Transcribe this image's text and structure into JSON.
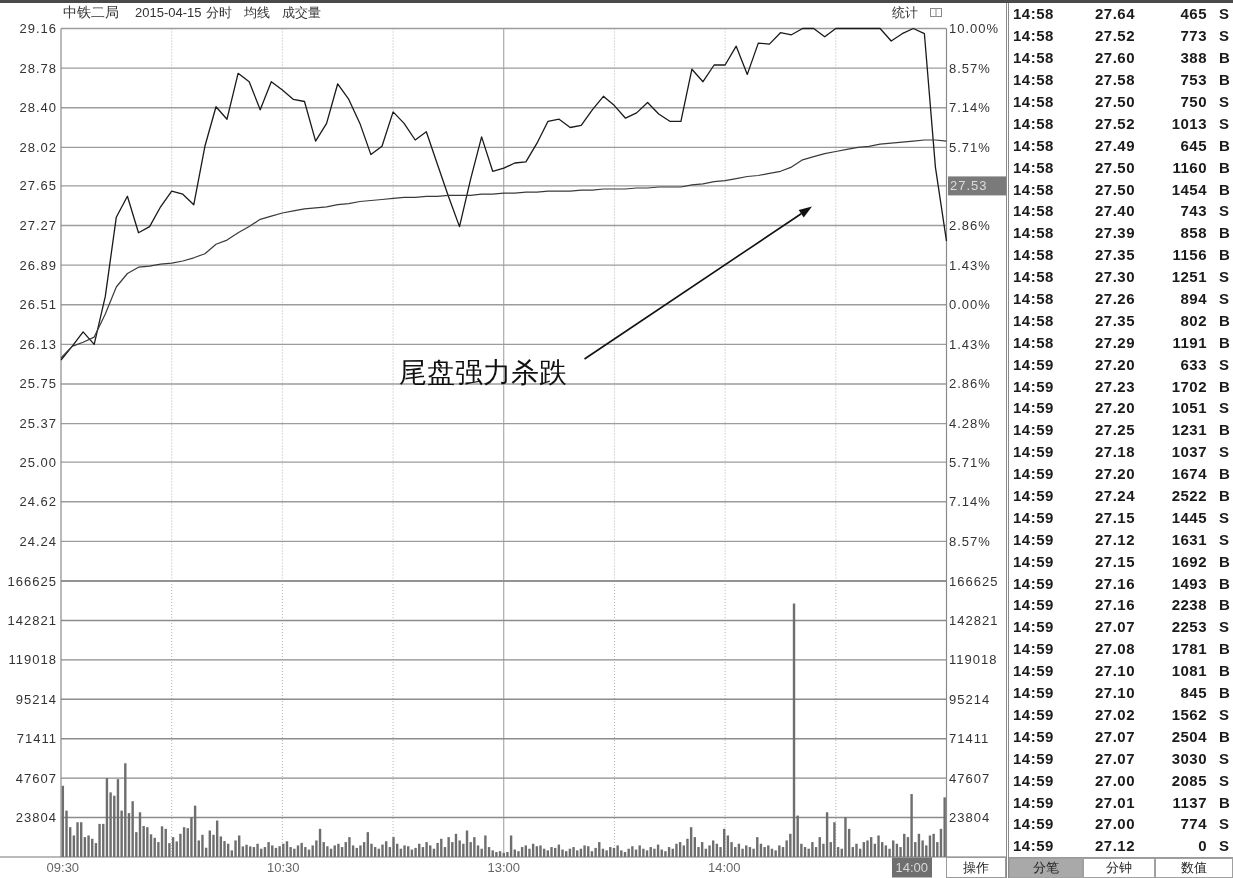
{
  "chart_header": {
    "stock_name": "中铁二局",
    "date": "2015-04-15",
    "stats_label": "统计"
  },
  "price_chart": {
    "chart_data": {
      "type": "line",
      "categories": [
        null,
        null,
        null,
        null,
        null,
        null,
        null,
        null,
        null,
        null,
        null,
        null,
        null,
        null,
        null,
        null,
        null,
        null,
        null,
        null,
        null,
        null,
        null,
        null,
        null,
        null,
        null,
        null,
        null,
        null,
        null,
        null,
        null,
        null,
        null,
        null,
        null,
        null,
        null,
        null,
        null,
        null,
        null,
        null,
        null,
        null,
        null,
        null,
        null,
        null,
        null,
        null,
        null,
        null,
        null,
        null,
        null,
        null,
        null,
        null,
        null,
        null,
        null,
        null,
        null,
        null,
        null,
        null,
        null,
        null,
        null,
        null,
        null,
        null,
        null,
        null,
        null,
        null,
        null,
        null,
        null
      ],
      "series": [
        {
          "name": "分时",
          "color": "#1a1a1a",
          "values": [
            25.98,
            26.11,
            26.25,
            26.13,
            26.59,
            27.35,
            27.55,
            27.2,
            27.26,
            27.45,
            27.6,
            27.57,
            27.47,
            28.03,
            28.41,
            28.29,
            28.73,
            28.65,
            28.38,
            28.65,
            28.57,
            28.48,
            28.46,
            28.08,
            28.25,
            28.63,
            28.48,
            28.25,
            27.95,
            28.03,
            28.36,
            28.25,
            28.09,
            28.17,
            27.86,
            27.55,
            27.26,
            27.71,
            28.12,
            27.79,
            27.82,
            27.87,
            27.88,
            28.06,
            28.27,
            28.29,
            28.21,
            28.23,
            28.38,
            28.51,
            28.42,
            28.3,
            28.35,
            28.45,
            28.34,
            28.27,
            28.27,
            28.77,
            28.65,
            28.81,
            28.81,
            28.99,
            28.72,
            29.02,
            29.01,
            29.12,
            29.1,
            29.16,
            29.16,
            29.08,
            29.16,
            29.16,
            29.16,
            29.16,
            29.16,
            29.04,
            29.11,
            29.16,
            29.11,
            27.83,
            27.12
          ]
        },
        {
          "name": "均线",
          "color": "#3a3a3a",
          "values": [
            26.0,
            26.11,
            26.15,
            26.2,
            26.42,
            26.68,
            26.81,
            26.87,
            26.88,
            26.9,
            26.91,
            26.93,
            26.96,
            27.0,
            27.09,
            27.13,
            27.2,
            27.26,
            27.33,
            27.36,
            27.39,
            27.41,
            27.43,
            27.44,
            27.45,
            27.47,
            27.48,
            27.5,
            27.51,
            27.52,
            27.53,
            27.54,
            27.54,
            27.55,
            27.55,
            27.56,
            27.56,
            27.56,
            27.57,
            27.57,
            27.58,
            27.58,
            27.59,
            27.59,
            27.6,
            27.6,
            27.6,
            27.61,
            27.61,
            27.62,
            27.62,
            27.62,
            27.63,
            27.63,
            27.64,
            27.64,
            27.64,
            27.66,
            27.67,
            27.69,
            27.7,
            27.72,
            27.74,
            27.75,
            27.77,
            27.79,
            27.83,
            27.9,
            27.93,
            27.96,
            27.98,
            28.0,
            28.02,
            28.03,
            28.05,
            28.06,
            28.07,
            28.08,
            28.09,
            28.09,
            28.08
          ]
        }
      ],
      "ylim": [
        23.86,
        29.16
      ],
      "grid": true,
      "yticks": [
        {
          "value": 29.16,
          "label": "29.16"
        },
        {
          "value": 28.78,
          "label": "28.78"
        },
        {
          "value": 28.4,
          "label": "28.40"
        },
        {
          "value": 28.02,
          "label": "28.02"
        },
        {
          "value": 27.65,
          "label": "27.65"
        },
        {
          "value": 27.27,
          "label": "27.27"
        },
        {
          "value": 26.89,
          "label": "26.89"
        },
        {
          "value": 26.51,
          "label": "26.51"
        },
        {
          "value": 26.13,
          "label": "26.13"
        },
        {
          "value": 25.75,
          "label": "25.75"
        },
        {
          "value": 25.37,
          "label": "25.37"
        },
        {
          "value": 25.0,
          "label": "25.00"
        },
        {
          "value": 24.62,
          "label": "24.62"
        },
        {
          "value": 24.24,
          "label": "24.24"
        }
      ],
      "annotations": [
        "尾盘强力杀跌"
      ]
    },
    "right_axis": [
      {
        "kind": "percent",
        "label": "10.00%"
      },
      {
        "kind": "percent",
        "label": "8.57%"
      },
      {
        "kind": "percent",
        "label": "7.14%"
      },
      {
        "kind": "percent",
        "label": "5.71%"
      },
      {
        "kind": "last_price",
        "label": "27.53"
      },
      {
        "kind": "percent",
        "label": "2.86%"
      },
      {
        "kind": "percent",
        "label": "1.43%"
      },
      {
        "kind": "percent",
        "label": "0.00%"
      },
      {
        "kind": "percent",
        "label": "1.43%"
      },
      {
        "kind": "percent",
        "label": "2.86%"
      },
      {
        "kind": "percent",
        "label": "4.28%"
      },
      {
        "kind": "percent",
        "label": "5.71%"
      },
      {
        "kind": "percent",
        "label": "7.14%"
      },
      {
        "kind": "percent",
        "label": "8.57%"
      }
    ]
  },
  "volume_chart": {
    "chart_data": {
      "type": "bar",
      "categories": [
        "09:30",
        null,
        null,
        null,
        null,
        null,
        null,
        null,
        null,
        null,
        null,
        null,
        null,
        null,
        null,
        null,
        null,
        null,
        null,
        null,
        null,
        null,
        null,
        null,
        null,
        null,
        null,
        null,
        null,
        null,
        null,
        null,
        null,
        null,
        null,
        null,
        null,
        null,
        null,
        null,
        null,
        null,
        null,
        null,
        null,
        null,
        null,
        null,
        null,
        null,
        null,
        null,
        null,
        null,
        null,
        null,
        null,
        null,
        null,
        null,
        "10:30",
        null,
        null,
        null,
        null,
        null,
        null,
        null,
        null,
        null,
        null,
        null,
        null,
        null,
        null,
        null,
        null,
        null,
        null,
        null,
        null,
        null,
        null,
        null,
        null,
        null,
        null,
        null,
        null,
        null,
        null,
        null,
        null,
        null,
        null,
        null,
        null,
        null,
        null,
        null,
        null,
        null,
        null,
        null,
        null,
        null,
        null,
        null,
        null,
        null,
        null,
        null,
        null,
        null,
        null,
        null,
        null,
        null,
        null,
        null,
        "13:00",
        null,
        null,
        null,
        null,
        null,
        null,
        null,
        null,
        null,
        null,
        null,
        null,
        null,
        null,
        null,
        null,
        null,
        null,
        null,
        null,
        null,
        null,
        null,
        null,
        null,
        null,
        null,
        null,
        null,
        null,
        null,
        null,
        null,
        null,
        null,
        null,
        null,
        null,
        null,
        null,
        null,
        null,
        null,
        null,
        null,
        null,
        null,
        null,
        null,
        null,
        null,
        null,
        null,
        null,
        null,
        null,
        null,
        null,
        null,
        "14:00",
        null,
        null,
        null,
        null,
        null,
        null,
        null,
        null,
        null,
        null,
        null,
        null,
        null,
        null,
        null,
        null,
        null,
        null,
        null,
        null,
        null,
        null,
        null,
        null,
        null,
        null,
        null,
        null,
        null,
        null,
        null,
        null,
        null,
        null,
        null,
        null,
        null,
        null,
        null,
        null,
        null,
        null,
        null,
        null,
        null,
        null,
        null,
        null,
        null,
        null,
        null,
        null,
        null,
        null,
        null,
        null,
        null,
        null,
        null,
        null
      ],
      "series": [
        {
          "name": "成交量",
          "color": "#6e6e6e",
          "values": [
            43000,
            28000,
            18000,
            13000,
            21000,
            21000,
            12000,
            13000,
            11000,
            8400,
            20000,
            20000,
            47600,
            39000,
            37000,
            47000,
            28000,
            56600,
            26500,
            33700,
            15000,
            27000,
            18700,
            18000,
            13700,
            11600,
            9000,
            18500,
            17000,
            8400,
            12000,
            9400,
            14000,
            18000,
            17400,
            24000,
            31000,
            10000,
            13400,
            5600,
            16000,
            13400,
            22000,
            12400,
            9600,
            8000,
            4000,
            10000,
            13000,
            6400,
            7400,
            6400,
            6000,
            8000,
            5000,
            6000,
            9000,
            7000,
            5500,
            6500,
            8000,
            9500,
            6000,
            5000,
            7000,
            8500,
            6000,
            4500,
            7000,
            10000,
            17000,
            9000,
            6500,
            5000,
            7000,
            8000,
            6000,
            9000,
            12000,
            7000,
            5500,
            7000,
            9000,
            15000,
            8000,
            6000,
            5000,
            7500,
            9500,
            6000,
            12000,
            8000,
            5000,
            7000,
            6500,
            4500,
            5500,
            8000,
            6000,
            9000,
            7000,
            5000,
            8500,
            11000,
            6000,
            12000,
            9000,
            14000,
            10000,
            8000,
            16000,
            9000,
            12000,
            7000,
            5000,
            13000,
            6000,
            4000,
            3000,
            3500,
            2500,
            3000,
            13000,
            4500,
            3500,
            6000,
            7000,
            5000,
            8000,
            6500,
            7000,
            5000,
            4000,
            6000,
            5500,
            7500,
            4500,
            3500,
            5000,
            6000,
            4000,
            5000,
            7000,
            6500,
            3500,
            5500,
            9000,
            5000,
            4000,
            6000,
            5500,
            7000,
            4000,
            3000,
            5000,
            6500,
            4500,
            7000,
            5000,
            4000,
            6000,
            5000,
            7500,
            4500,
            3500,
            6000,
            5000,
            8000,
            9000,
            7000,
            11000,
            18000,
            12000,
            6000,
            9000,
            5000,
            7000,
            10000,
            8000,
            6000,
            17000,
            13000,
            9000,
            6000,
            8000,
            5000,
            7000,
            6000,
            5000,
            12000,
            8000,
            6000,
            7000,
            5000,
            4000,
            7000,
            6000,
            10000,
            14000,
            153000,
            25000,
            8000,
            6000,
            5000,
            9000,
            6000,
            12000,
            8000,
            27000,
            9000,
            21000,
            6000,
            5000,
            24000,
            17000,
            6000,
            8000,
            5000,
            9000,
            10000,
            12000,
            8000,
            13000,
            9000,
            7000,
            5000,
            10000,
            8000,
            6000,
            14000,
            12000,
            38000,
            9000,
            14000,
            10000,
            7000,
            13000,
            14000,
            9000,
            17000,
            36000
          ]
        }
      ],
      "ylim": [
        0,
        166625
      ],
      "grid": true,
      "yticks": [
        {
          "value": 166625,
          "label": "166625"
        },
        {
          "value": 142821,
          "label": "142821"
        },
        {
          "value": 119018,
          "label": "119018"
        },
        {
          "value": 95214,
          "label": "95214"
        },
        {
          "value": 71411,
          "label": "71411"
        },
        {
          "value": 47607,
          "label": "47607"
        },
        {
          "value": 23804,
          "label": "23804"
        }
      ]
    },
    "right_axis": [
      "166625",
      "142821",
      "119018",
      "95214",
      "71411",
      "47607",
      "23804"
    ],
    "cursor_time": "14:00"
  },
  "operate_button": "操作",
  "tick_panel": {
    "rows": [
      {
        "time": "14:58",
        "price": "27.64",
        "volume": "465",
        "side": "S"
      },
      {
        "time": "14:58",
        "price": "27.52",
        "volume": "773",
        "side": "S"
      },
      {
        "time": "14:58",
        "price": "27.60",
        "volume": "388",
        "side": "B"
      },
      {
        "time": "14:58",
        "price": "27.58",
        "volume": "753",
        "side": "B"
      },
      {
        "time": "14:58",
        "price": "27.50",
        "volume": "750",
        "side": "S"
      },
      {
        "time": "14:58",
        "price": "27.52",
        "volume": "1013",
        "side": "S"
      },
      {
        "time": "14:58",
        "price": "27.49",
        "volume": "645",
        "side": "B"
      },
      {
        "time": "14:58",
        "price": "27.50",
        "volume": "1160",
        "side": "B"
      },
      {
        "time": "14:58",
        "price": "27.50",
        "volume": "1454",
        "side": "B"
      },
      {
        "time": "14:58",
        "price": "27.40",
        "volume": "743",
        "side": "S"
      },
      {
        "time": "14:58",
        "price": "27.39",
        "volume": "858",
        "side": "B"
      },
      {
        "time": "14:58",
        "price": "27.35",
        "volume": "1156",
        "side": "B"
      },
      {
        "time": "14:58",
        "price": "27.30",
        "volume": "1251",
        "side": "S"
      },
      {
        "time": "14:58",
        "price": "27.26",
        "volume": "894",
        "side": "S"
      },
      {
        "time": "14:58",
        "price": "27.35",
        "volume": "802",
        "side": "B"
      },
      {
        "time": "14:58",
        "price": "27.29",
        "volume": "1191",
        "side": "B"
      },
      {
        "time": "14:59",
        "price": "27.20",
        "volume": "633",
        "side": "S"
      },
      {
        "time": "14:59",
        "price": "27.23",
        "volume": "1702",
        "side": "B"
      },
      {
        "time": "14:59",
        "price": "27.20",
        "volume": "1051",
        "side": "S"
      },
      {
        "time": "14:59",
        "price": "27.25",
        "volume": "1231",
        "side": "B"
      },
      {
        "time": "14:59",
        "price": "27.18",
        "volume": "1037",
        "side": "S"
      },
      {
        "time": "14:59",
        "price": "27.20",
        "volume": "1674",
        "side": "B"
      },
      {
        "time": "14:59",
        "price": "27.24",
        "volume": "2522",
        "side": "B"
      },
      {
        "time": "14:59",
        "price": "27.15",
        "volume": "1445",
        "side": "S"
      },
      {
        "time": "14:59",
        "price": "27.12",
        "volume": "1631",
        "side": "S"
      },
      {
        "time": "14:59",
        "price": "27.15",
        "volume": "1692",
        "side": "B"
      },
      {
        "time": "14:59",
        "price": "27.16",
        "volume": "1493",
        "side": "B"
      },
      {
        "time": "14:59",
        "price": "27.16",
        "volume": "2238",
        "side": "B"
      },
      {
        "time": "14:59",
        "price": "27.07",
        "volume": "2253",
        "side": "S"
      },
      {
        "time": "14:59",
        "price": "27.08",
        "volume": "1781",
        "side": "B"
      },
      {
        "time": "14:59",
        "price": "27.10",
        "volume": "1081",
        "side": "B"
      },
      {
        "time": "14:59",
        "price": "27.10",
        "volume": "845",
        "side": "B"
      },
      {
        "time": "14:59",
        "price": "27.02",
        "volume": "1562",
        "side": "S"
      },
      {
        "time": "14:59",
        "price": "27.07",
        "volume": "2504",
        "side": "B"
      },
      {
        "time": "14:59",
        "price": "27.07",
        "volume": "3030",
        "side": "S"
      },
      {
        "time": "14:59",
        "price": "27.00",
        "volume": "2085",
        "side": "S"
      },
      {
        "time": "14:59",
        "price": "27.01",
        "volume": "1137",
        "side": "B"
      },
      {
        "time": "14:59",
        "price": "27.00",
        "volume": "774",
        "side": "S"
      },
      {
        "time": "14:59",
        "price": "27.12",
        "volume": "0",
        "side": "S"
      }
    ],
    "tabs": [
      {
        "label": "分笔",
        "selected": true
      },
      {
        "label": "分钟",
        "selected": false
      },
      {
        "label": "数值",
        "selected": false
      }
    ]
  }
}
